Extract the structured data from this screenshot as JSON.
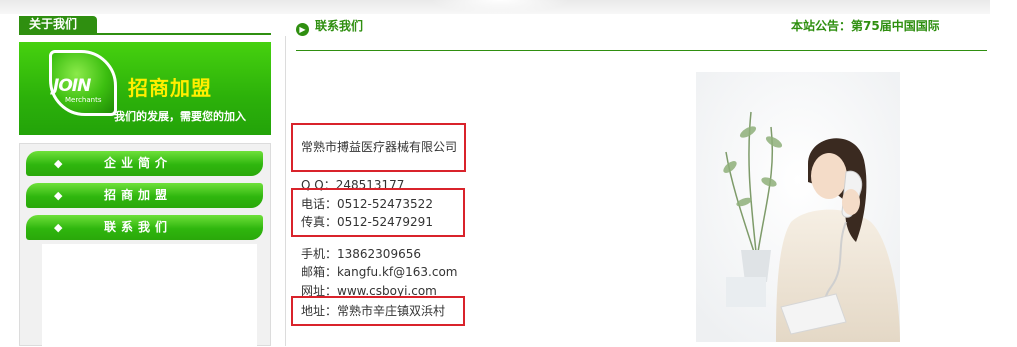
{
  "sidebar": {
    "about_tab": "关于我们",
    "banner": {
      "logo_main": "JOIN",
      "logo_sub": "Merchants",
      "title": "招商加盟",
      "subtitle": "我们的发展，需要您的加入"
    },
    "menu": [
      {
        "icon": "◆",
        "label": "企业简介"
      },
      {
        "icon": "◆",
        "label": "招商加盟"
      },
      {
        "icon": "◆",
        "label": "联系我们"
      }
    ]
  },
  "header": {
    "section_title": "联系我们",
    "notice": "本站公告：第75届中国国际"
  },
  "contact": {
    "company": "常熟市搏益医疗器械有限公司",
    "qq": "Q Q：248513177",
    "phone": "电话：0512-52473522",
    "fax": "传真：0512-52479291",
    "mobile": "手机：13862309656",
    "email": "邮箱：kangfu.kf@163.com",
    "website": "网址：www.csboyi.com",
    "address": "地址：常熟市辛庄镇双浜村"
  },
  "colors": {
    "brand_green": "#2f8f10",
    "highlight_red": "#d9232b",
    "banner_yellow": "#ffee00"
  }
}
